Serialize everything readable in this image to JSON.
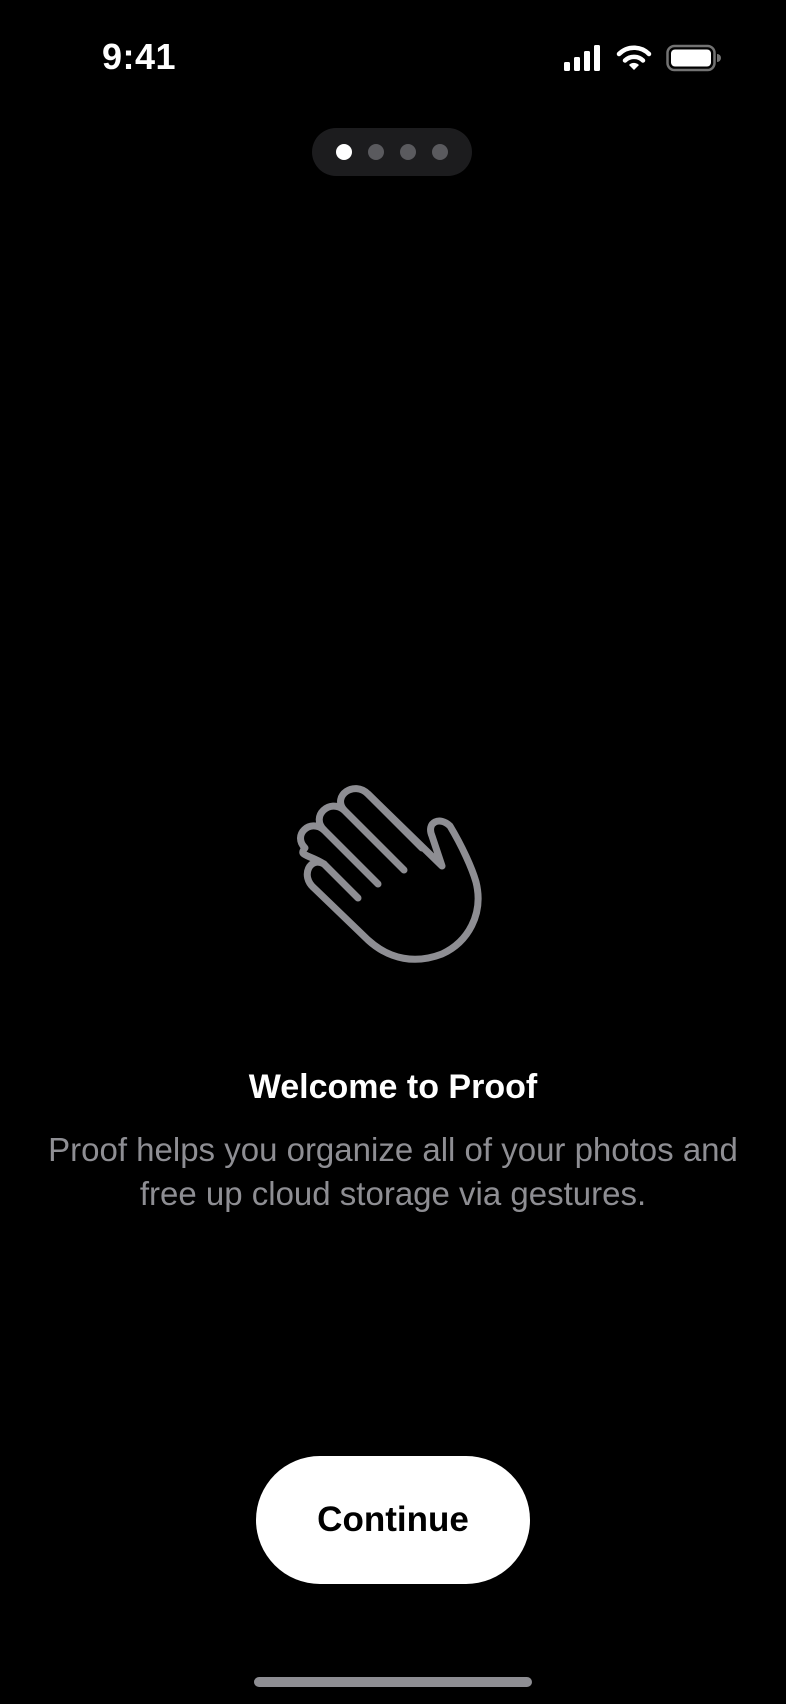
{
  "status_bar": {
    "time": "9:41",
    "icons": [
      "cellular-signal-icon",
      "wifi-icon",
      "battery-icon"
    ]
  },
  "page_indicator": {
    "total_pages": 4,
    "current_page": 1
  },
  "onboarding": {
    "icon": "waving-hand-icon",
    "title": "Welcome to Proof",
    "description": "Proof helps you organize all of your photos and free up cloud storage via gestures."
  },
  "actions": {
    "continue_label": "Continue"
  },
  "colors": {
    "background": "#000000",
    "primary_text": "#ffffff",
    "secondary_text": "#8e8e93",
    "button_background": "#ffffff",
    "button_text": "#000000",
    "indicator_background": "#1c1c1e",
    "dot_inactive": "#5a5a5e"
  }
}
